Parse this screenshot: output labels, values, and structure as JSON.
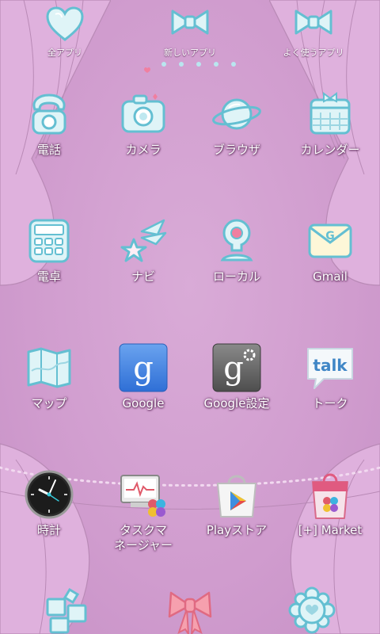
{
  "top_tabs": [
    {
      "label": "全アプリ",
      "icon": "heart-icon"
    },
    {
      "label": "新しいアプリ",
      "icon": "bow-icon"
    },
    {
      "label": "よく使うアプリ",
      "icon": "bow-icon"
    }
  ],
  "page_indicator": {
    "total": 6,
    "current": 1
  },
  "apps": [
    {
      "label": "電話",
      "icon": "phone-icon"
    },
    {
      "label": "カメラ",
      "icon": "camera-icon"
    },
    {
      "label": "ブラウザ",
      "icon": "planet-icon"
    },
    {
      "label": "カレンダー",
      "icon": "calendar-icon"
    },
    {
      "label": "電卓",
      "icon": "calculator-icon"
    },
    {
      "label": "ナビ",
      "icon": "shooting-star-icon"
    },
    {
      "label": "ローカル",
      "icon": "map-pin-icon"
    },
    {
      "label": "Gmail",
      "icon": "mail-icon"
    },
    {
      "label": "マップ",
      "icon": "map-icon"
    },
    {
      "label": "Google",
      "icon": "google-search-icon",
      "glyph": "g"
    },
    {
      "label": "Google設定",
      "icon": "google-settings-icon",
      "glyph": "g"
    },
    {
      "label": "トーク",
      "icon": "talk-icon",
      "glyph": "talk"
    },
    {
      "label": "時計",
      "icon": "clock-icon"
    },
    {
      "label": "タスクマネージャー",
      "label_lines": [
        "タスクマ",
        "ネージャー"
      ],
      "icon": "task-manager-icon"
    },
    {
      "label": "Playストア",
      "icon": "play-store-icon"
    },
    {
      "label": "[+] Market",
      "icon": "market-bag-icon"
    }
  ],
  "dock": [
    {
      "name": "widget-blocks-icon"
    },
    {
      "name": "bow-icon"
    },
    {
      "name": "flower-gear-icon"
    }
  ],
  "colors": {
    "background": "#d5a4d3",
    "curtain": "#dfb1dd",
    "icon_fill": "#dff4f7",
    "icon_stroke": "#64bfd2",
    "accent_pink": "#f07fa0",
    "google_blue": "#3e7fe0"
  }
}
